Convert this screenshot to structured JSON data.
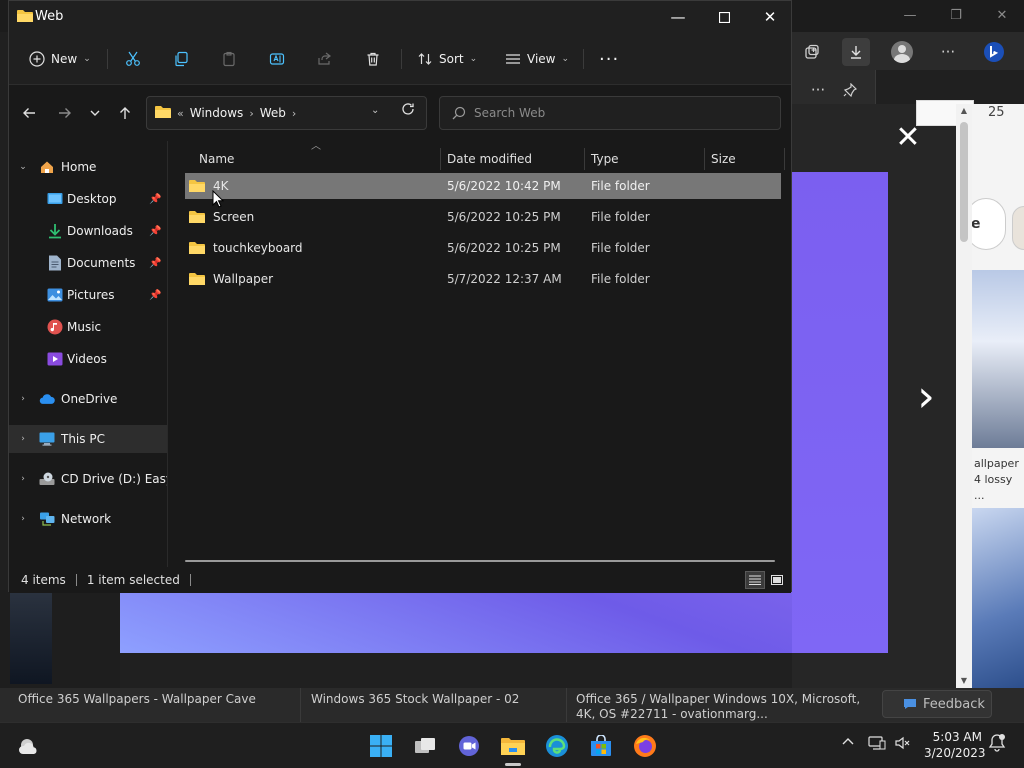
{
  "explorer": {
    "title": "Web",
    "commands": {
      "new_label": "New",
      "sort_label": "Sort",
      "view_label": "View"
    },
    "address": {
      "overflow": "«",
      "segments": [
        "Windows",
        "Web"
      ]
    },
    "search_placeholder": "Search Web",
    "sidebar": {
      "items": [
        {
          "label": "Home"
        },
        {
          "label": "Desktop"
        },
        {
          "label": "Downloads"
        },
        {
          "label": "Documents"
        },
        {
          "label": "Pictures"
        },
        {
          "label": "Music"
        },
        {
          "label": "Videos"
        },
        {
          "label": "OneDrive"
        },
        {
          "label": "This PC"
        },
        {
          "label": "CD Drive (D:) EasyKMS"
        },
        {
          "label": "Network"
        }
      ]
    },
    "columns": {
      "name": "Name",
      "date_modified": "Date modified",
      "type": "Type",
      "size": "Size"
    },
    "rows": [
      {
        "name": "4K",
        "date": "5/6/2022 10:42 PM",
        "type": "File folder",
        "size": ""
      },
      {
        "name": "Screen",
        "date": "5/6/2022 10:25 PM",
        "type": "File folder",
        "size": ""
      },
      {
        "name": "touchkeyboard",
        "date": "5/6/2022 10:25 PM",
        "type": "File folder",
        "size": ""
      },
      {
        "name": "Wallpaper",
        "date": "5/7/2022 12:37 AM",
        "type": "File folder",
        "size": ""
      }
    ],
    "status": {
      "items": "4 items",
      "selected": "1 item selected"
    }
  },
  "browser": {
    "captions": [
      "Office 365 Wallpapers - Wallpaper Cave",
      "Windows 365 Stock Wallpaper - 02",
      "Office 365 / Wallpaper Windows 10X, Microsoft, 4K, OS #22711 - ovationmarg..."
    ],
    "feedback_label": "Feedback",
    "side_caption": "allpaper 4 lossy ...",
    "pill_text": "e",
    "top_number": "25"
  },
  "taskbar": {
    "time": "5:03 AM",
    "date": "3/20/2023"
  },
  "colors": {
    "accent": "#4cc2ff",
    "folder_yellow": "#f4c542",
    "selection": "#777777"
  }
}
